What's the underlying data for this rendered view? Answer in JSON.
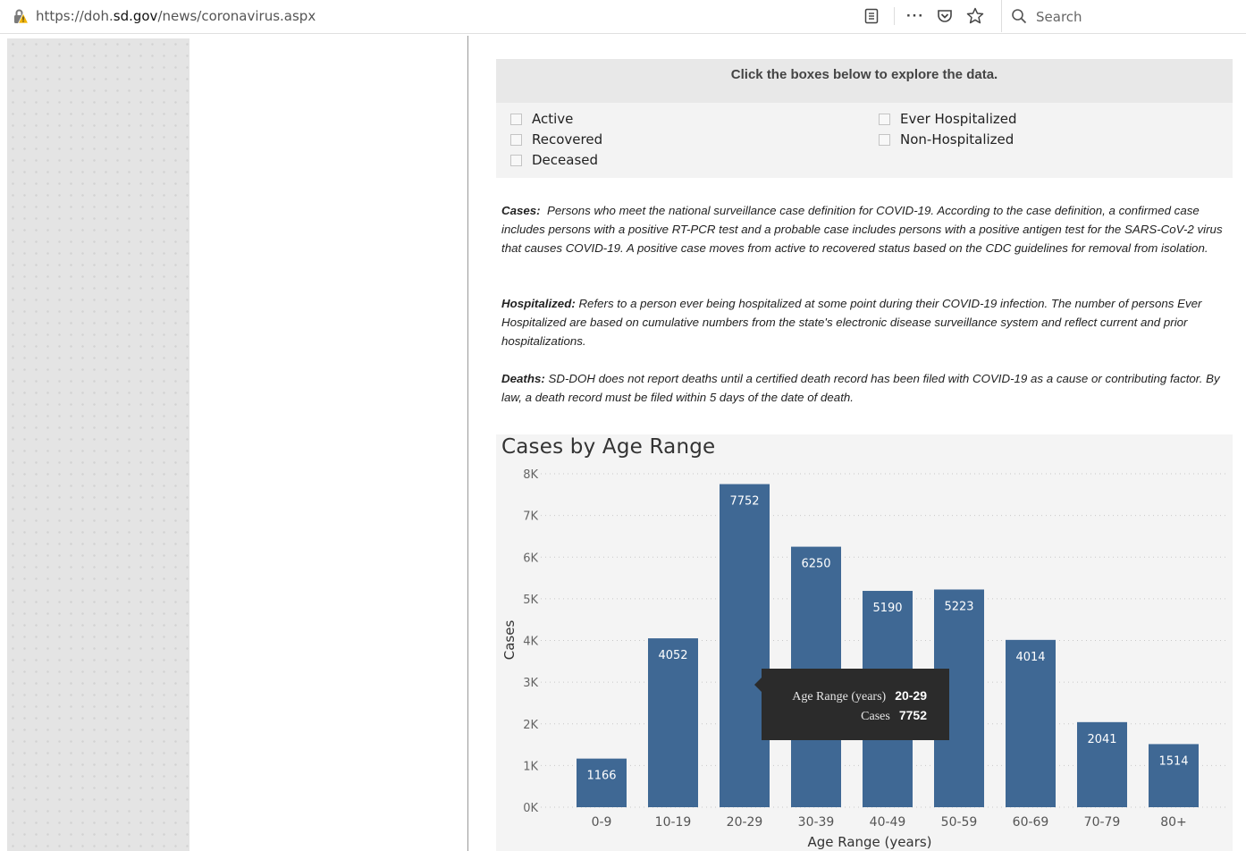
{
  "browser": {
    "url_prefix": "https://doh.",
    "url_domain": "sd.gov",
    "url_path": "/news/coronavirus.aspx",
    "search_placeholder": "Search"
  },
  "explore": {
    "header": "Click the boxes below to explore the data.",
    "filters_left": [
      "Active",
      "Recovered",
      "Deceased"
    ],
    "filters_right": [
      "Ever Hospitalized",
      "Non-Hospitalized"
    ]
  },
  "definitions": {
    "cases_term": "Cases:",
    "cases_text": "Persons who meet the national surveillance case definition for COVID-19. According to the case definition, a confirmed case includes persons with a positive RT-PCR test and a probable case includes persons with a positive antigen test for the SARS-CoV-2 virus that causes COVID-19. A positive case moves from active to recovered status based on the CDC guidelines for removal from isolation.",
    "hosp_term": "Hospitalized:",
    "hosp_text": "Refers to a person ever being hospitalized at some point during their COVID-19 infection. The number of persons Ever Hospitalized are based on cumulative numbers from the state's electronic disease surveillance system and reflect current and prior hospitalizations.",
    "deaths_term": "Deaths:",
    "deaths_text": "SD-DOH does not report deaths until a certified death record has been filed with COVID-19 as a cause or contributing factor. By law, a death record must be filed within 5 days of the date of death."
  },
  "tooltip": {
    "key1": "Age Range (years)",
    "val1": "20-29",
    "key2": "Cases",
    "val2": "7752"
  },
  "colors": {
    "bar": "#3f6894",
    "tooltip_bg": "#2b2b2b"
  },
  "chart_data": {
    "type": "bar",
    "title": "Cases by Age Range",
    "xlabel": "Age Range (years)",
    "ylabel": "Cases",
    "categories": [
      "0-9",
      "10-19",
      "20-29",
      "30-39",
      "40-49",
      "50-59",
      "60-69",
      "70-79",
      "80+"
    ],
    "values": [
      1166,
      4052,
      7752,
      6250,
      5190,
      5223,
      4014,
      2041,
      1514
    ],
    "ylim": [
      0,
      8000
    ],
    "yticks": [
      0,
      1000,
      2000,
      3000,
      4000,
      5000,
      6000,
      7000,
      8000
    ],
    "ytick_labels": [
      "0K",
      "1K",
      "2K",
      "3K",
      "4K",
      "5K",
      "6K",
      "7K",
      "8K"
    ],
    "grid": true
  }
}
